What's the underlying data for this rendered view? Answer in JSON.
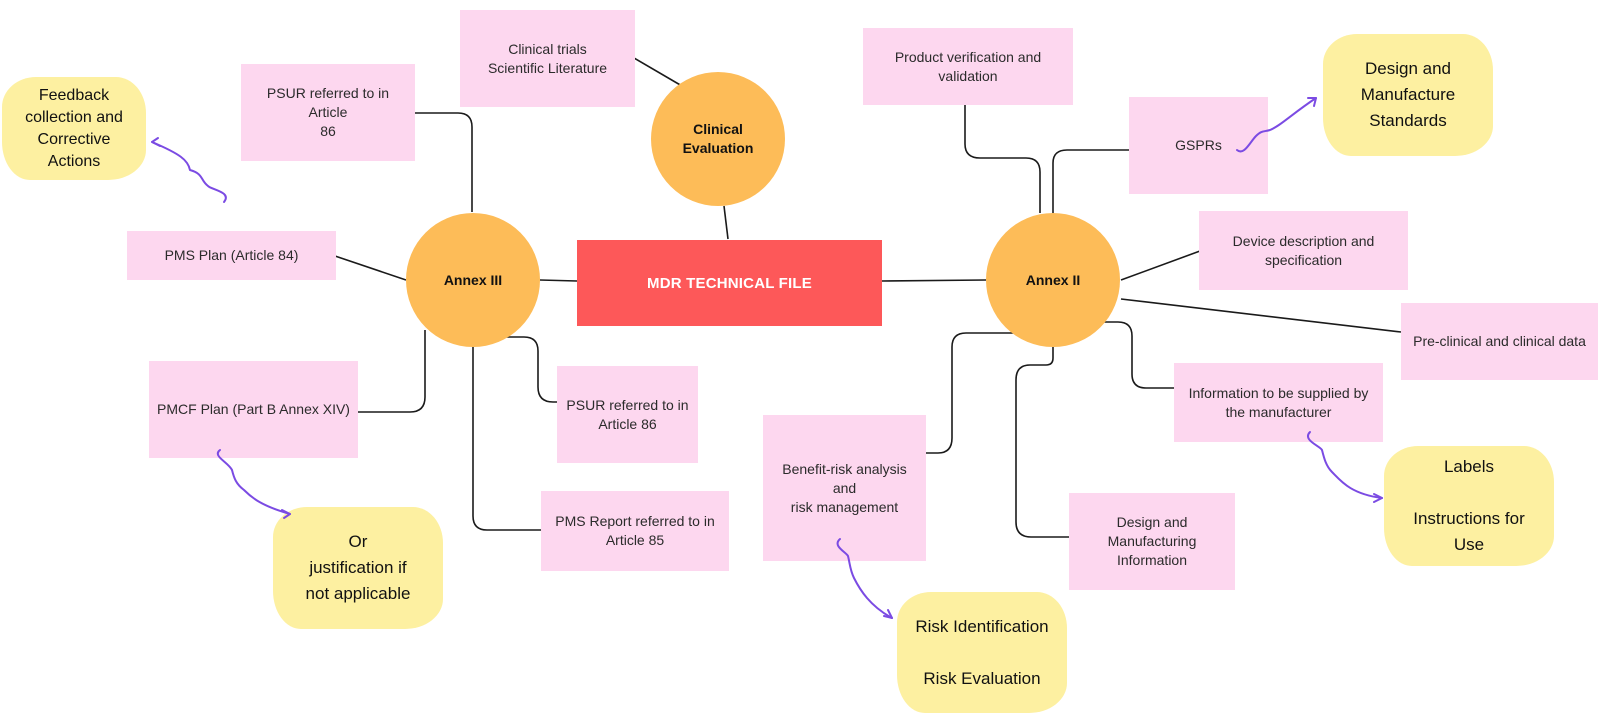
{
  "diagram": {
    "title": "MDR TECHNICAL FILE",
    "colors": {
      "central": "#fd5859",
      "hub": "#fdbc58",
      "sticky": "#fdd7ef",
      "note": "#fdf0a1",
      "arrow": "#7b4be3",
      "connector": "#1a1a1a"
    },
    "hubs": {
      "clinical_evaluation": "Clinical\nEvaluation",
      "annex_iii": "Annex III",
      "annex_ii": "Annex II"
    },
    "clinical_evaluation_items": {
      "sources": "Clinical trials\nScientific Literature"
    },
    "annex_iii_items": {
      "psur_top": "PSUR referred to in Article\n86",
      "pms_plan": "PMS Plan (Article 84)",
      "pmcf_plan": "PMCF Plan (Part B Annex XIV)",
      "psur_bottom": "PSUR referred to in\nArticle 86",
      "pms_report": "PMS Report referred to in\nArticle 85"
    },
    "annex_ii_items": {
      "verification": "Product verification and\nvalidation",
      "gsprs": "GSPRs",
      "device_description": "Device description and\nspecification",
      "preclinical": "Pre-clinical and clinical data",
      "information_supplied": "Information to be supplied by\nthe manufacturer",
      "design_manufacturing": "Design and\nManufacturing\nInformation",
      "benefit_risk": "Benefit-risk analysis and\nrisk management"
    },
    "notes": {
      "feedback": "Feedback\ncollection and\nCorrective\nActions",
      "justification": "Or\njustification if\nnot applicable",
      "standards": "Design and\nManufacture\nStandards",
      "labels": "Labels\n\nInstructions for\nUse",
      "risk": "Risk Identification\n\nRisk Evaluation"
    }
  }
}
